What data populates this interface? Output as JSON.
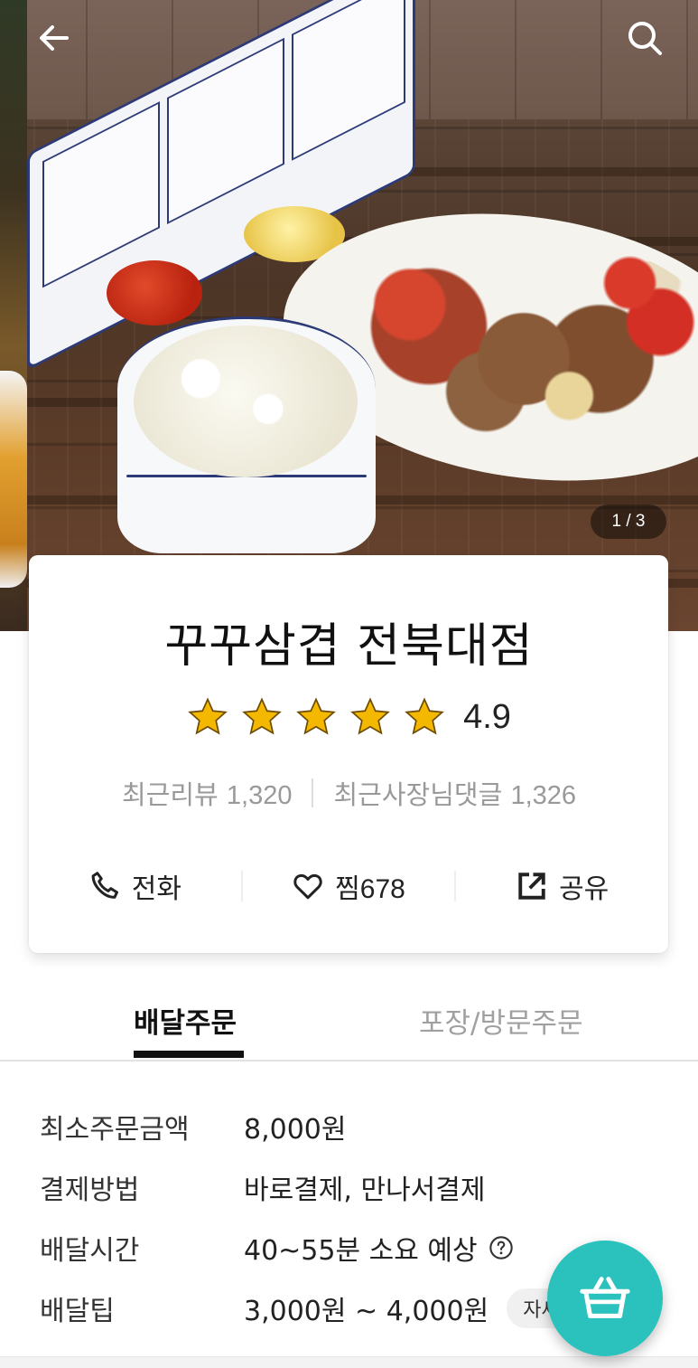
{
  "hero": {
    "image_counter": "1 / 3"
  },
  "store": {
    "name": "꾸꾸삼겹 전북대점",
    "rating": "4.9",
    "star_count": 5,
    "recent_reviews_label": "최근리뷰",
    "recent_reviews_count": "1,320",
    "owner_replies_label": "최근사장님댓글",
    "owner_replies_count": "1,326"
  },
  "actions": {
    "call_label": "전화",
    "like_label": "찜",
    "like_count": "678",
    "share_label": "공유"
  },
  "tabs": {
    "delivery": "배달주문",
    "pickup": "포장/방문주문"
  },
  "info": {
    "min_order": {
      "label": "최소주문금액",
      "value": "8,000원"
    },
    "payment": {
      "label": "결제방법",
      "value": "바로결제, 만나서결제"
    },
    "delivery_time": {
      "label": "배달시간",
      "value": "40~55분 소요 예상"
    },
    "delivery_tip": {
      "label": "배달팁",
      "value": "3,000원 ~ 4,000원",
      "detail_button": "자세히"
    }
  },
  "colors": {
    "accent": "#2bc1bc",
    "star": "#f5b800",
    "text_primary": "#222222",
    "text_muted": "#999999"
  },
  "icons": [
    "back-arrow-icon",
    "search-icon",
    "star-icon",
    "phone-icon",
    "heart-icon",
    "share-icon",
    "help-circle-icon",
    "cart-basket-icon"
  ]
}
